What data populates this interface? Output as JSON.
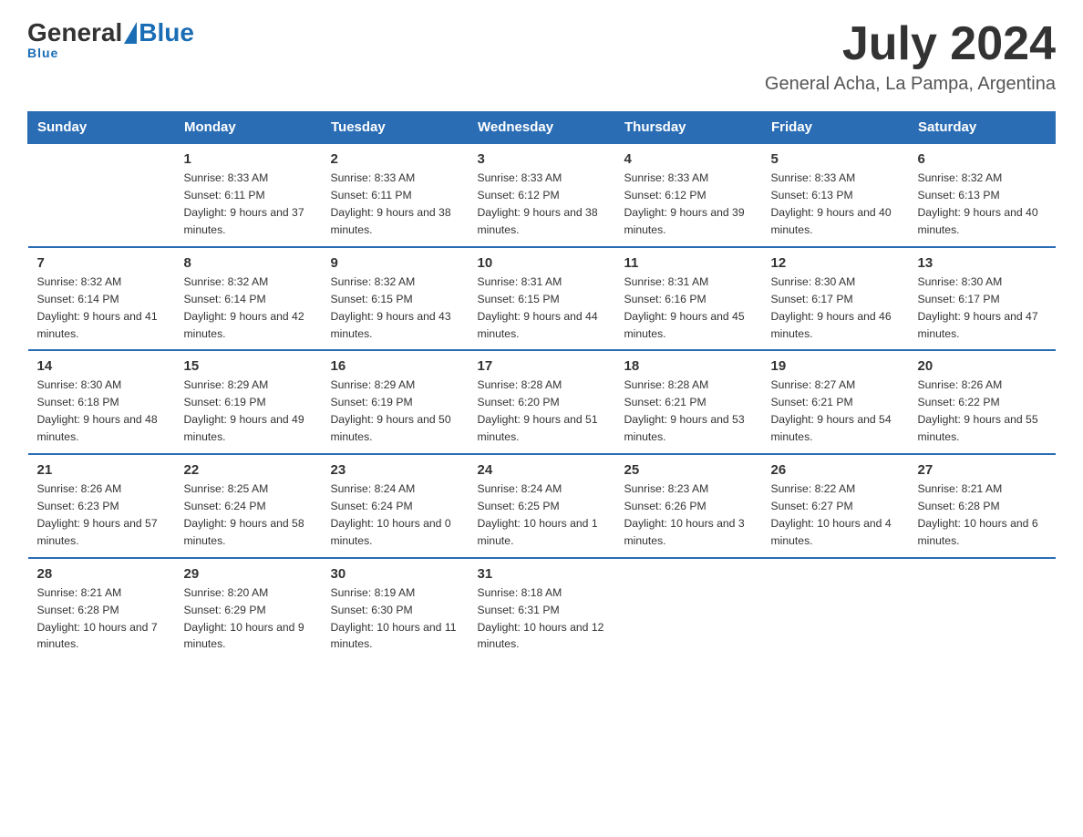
{
  "header": {
    "logo_general": "General",
    "logo_blue": "Blue",
    "month_year": "July 2024",
    "location": "General Acha, La Pampa, Argentina"
  },
  "weekdays": [
    "Sunday",
    "Monday",
    "Tuesday",
    "Wednesday",
    "Thursday",
    "Friday",
    "Saturday"
  ],
  "weeks": [
    [
      {
        "day": "",
        "sunrise": "",
        "sunset": "",
        "daylight": ""
      },
      {
        "day": "1",
        "sunrise": "Sunrise: 8:33 AM",
        "sunset": "Sunset: 6:11 PM",
        "daylight": "Daylight: 9 hours and 37 minutes."
      },
      {
        "day": "2",
        "sunrise": "Sunrise: 8:33 AM",
        "sunset": "Sunset: 6:11 PM",
        "daylight": "Daylight: 9 hours and 38 minutes."
      },
      {
        "day": "3",
        "sunrise": "Sunrise: 8:33 AM",
        "sunset": "Sunset: 6:12 PM",
        "daylight": "Daylight: 9 hours and 38 minutes."
      },
      {
        "day": "4",
        "sunrise": "Sunrise: 8:33 AM",
        "sunset": "Sunset: 6:12 PM",
        "daylight": "Daylight: 9 hours and 39 minutes."
      },
      {
        "day": "5",
        "sunrise": "Sunrise: 8:33 AM",
        "sunset": "Sunset: 6:13 PM",
        "daylight": "Daylight: 9 hours and 40 minutes."
      },
      {
        "day": "6",
        "sunrise": "Sunrise: 8:32 AM",
        "sunset": "Sunset: 6:13 PM",
        "daylight": "Daylight: 9 hours and 40 minutes."
      }
    ],
    [
      {
        "day": "7",
        "sunrise": "Sunrise: 8:32 AM",
        "sunset": "Sunset: 6:14 PM",
        "daylight": "Daylight: 9 hours and 41 minutes."
      },
      {
        "day": "8",
        "sunrise": "Sunrise: 8:32 AM",
        "sunset": "Sunset: 6:14 PM",
        "daylight": "Daylight: 9 hours and 42 minutes."
      },
      {
        "day": "9",
        "sunrise": "Sunrise: 8:32 AM",
        "sunset": "Sunset: 6:15 PM",
        "daylight": "Daylight: 9 hours and 43 minutes."
      },
      {
        "day": "10",
        "sunrise": "Sunrise: 8:31 AM",
        "sunset": "Sunset: 6:15 PM",
        "daylight": "Daylight: 9 hours and 44 minutes."
      },
      {
        "day": "11",
        "sunrise": "Sunrise: 8:31 AM",
        "sunset": "Sunset: 6:16 PM",
        "daylight": "Daylight: 9 hours and 45 minutes."
      },
      {
        "day": "12",
        "sunrise": "Sunrise: 8:30 AM",
        "sunset": "Sunset: 6:17 PM",
        "daylight": "Daylight: 9 hours and 46 minutes."
      },
      {
        "day": "13",
        "sunrise": "Sunrise: 8:30 AM",
        "sunset": "Sunset: 6:17 PM",
        "daylight": "Daylight: 9 hours and 47 minutes."
      }
    ],
    [
      {
        "day": "14",
        "sunrise": "Sunrise: 8:30 AM",
        "sunset": "Sunset: 6:18 PM",
        "daylight": "Daylight: 9 hours and 48 minutes."
      },
      {
        "day": "15",
        "sunrise": "Sunrise: 8:29 AM",
        "sunset": "Sunset: 6:19 PM",
        "daylight": "Daylight: 9 hours and 49 minutes."
      },
      {
        "day": "16",
        "sunrise": "Sunrise: 8:29 AM",
        "sunset": "Sunset: 6:19 PM",
        "daylight": "Daylight: 9 hours and 50 minutes."
      },
      {
        "day": "17",
        "sunrise": "Sunrise: 8:28 AM",
        "sunset": "Sunset: 6:20 PM",
        "daylight": "Daylight: 9 hours and 51 minutes."
      },
      {
        "day": "18",
        "sunrise": "Sunrise: 8:28 AM",
        "sunset": "Sunset: 6:21 PM",
        "daylight": "Daylight: 9 hours and 53 minutes."
      },
      {
        "day": "19",
        "sunrise": "Sunrise: 8:27 AM",
        "sunset": "Sunset: 6:21 PM",
        "daylight": "Daylight: 9 hours and 54 minutes."
      },
      {
        "day": "20",
        "sunrise": "Sunrise: 8:26 AM",
        "sunset": "Sunset: 6:22 PM",
        "daylight": "Daylight: 9 hours and 55 minutes."
      }
    ],
    [
      {
        "day": "21",
        "sunrise": "Sunrise: 8:26 AM",
        "sunset": "Sunset: 6:23 PM",
        "daylight": "Daylight: 9 hours and 57 minutes."
      },
      {
        "day": "22",
        "sunrise": "Sunrise: 8:25 AM",
        "sunset": "Sunset: 6:24 PM",
        "daylight": "Daylight: 9 hours and 58 minutes."
      },
      {
        "day": "23",
        "sunrise": "Sunrise: 8:24 AM",
        "sunset": "Sunset: 6:24 PM",
        "daylight": "Daylight: 10 hours and 0 minutes."
      },
      {
        "day": "24",
        "sunrise": "Sunrise: 8:24 AM",
        "sunset": "Sunset: 6:25 PM",
        "daylight": "Daylight: 10 hours and 1 minute."
      },
      {
        "day": "25",
        "sunrise": "Sunrise: 8:23 AM",
        "sunset": "Sunset: 6:26 PM",
        "daylight": "Daylight: 10 hours and 3 minutes."
      },
      {
        "day": "26",
        "sunrise": "Sunrise: 8:22 AM",
        "sunset": "Sunset: 6:27 PM",
        "daylight": "Daylight: 10 hours and 4 minutes."
      },
      {
        "day": "27",
        "sunrise": "Sunrise: 8:21 AM",
        "sunset": "Sunset: 6:28 PM",
        "daylight": "Daylight: 10 hours and 6 minutes."
      }
    ],
    [
      {
        "day": "28",
        "sunrise": "Sunrise: 8:21 AM",
        "sunset": "Sunset: 6:28 PM",
        "daylight": "Daylight: 10 hours and 7 minutes."
      },
      {
        "day": "29",
        "sunrise": "Sunrise: 8:20 AM",
        "sunset": "Sunset: 6:29 PM",
        "daylight": "Daylight: 10 hours and 9 minutes."
      },
      {
        "day": "30",
        "sunrise": "Sunrise: 8:19 AM",
        "sunset": "Sunset: 6:30 PM",
        "daylight": "Daylight: 10 hours and 11 minutes."
      },
      {
        "day": "31",
        "sunrise": "Sunrise: 8:18 AM",
        "sunset": "Sunset: 6:31 PM",
        "daylight": "Daylight: 10 hours and 12 minutes."
      },
      {
        "day": "",
        "sunrise": "",
        "sunset": "",
        "daylight": ""
      },
      {
        "day": "",
        "sunrise": "",
        "sunset": "",
        "daylight": ""
      },
      {
        "day": "",
        "sunrise": "",
        "sunset": "",
        "daylight": ""
      }
    ]
  ]
}
